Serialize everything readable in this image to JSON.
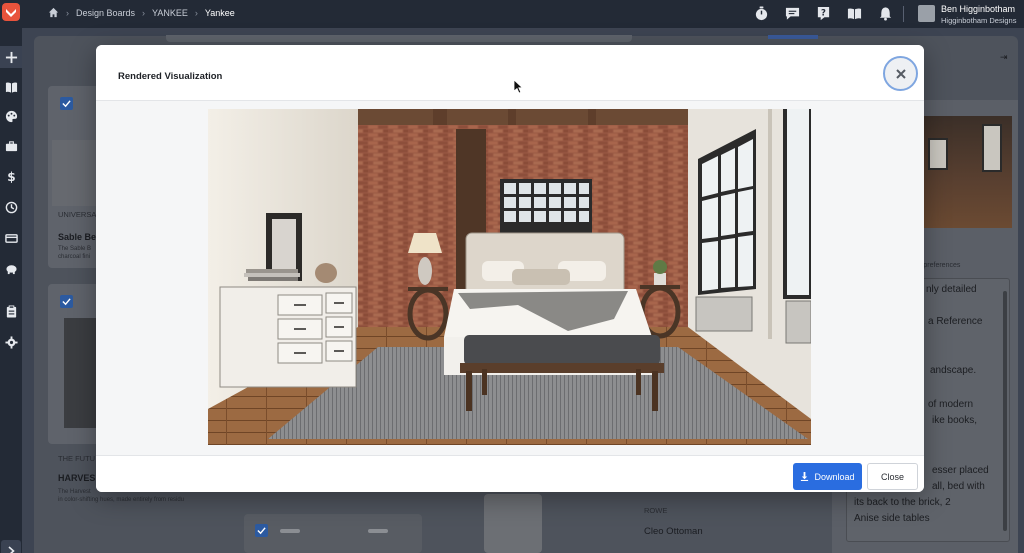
{
  "breadcrumb": {
    "items": [
      "Design Boards",
      "YANKEE",
      "Yankee"
    ]
  },
  "user": {
    "name": "Ben Higginbotham",
    "company": "Higginbotham Designs"
  },
  "topbar_icons": [
    "timer-icon",
    "chat-icon",
    "help-icon",
    "book-icon",
    "bell-icon"
  ],
  "sidebar_icons": [
    "add-icon",
    "catalog-icon",
    "palette-icon",
    "briefcase-icon",
    "dollar-icon",
    "clock-icon",
    "card-icon",
    "piggy-bank-icon",
    "clipboard-icon",
    "settings-icon",
    "chevron-right-icon"
  ],
  "background": {
    "card1": {
      "brand": "UNIVERSA",
      "title": "Sable Be",
      "desc": [
        "The Sable B",
        "charcoal fini"
      ]
    },
    "card2": {
      "brand": "THE FUTU",
      "title": "HARVES",
      "desc": [
        "The Harvest",
        "in color-shifting hues, made entirely from residu"
      ]
    },
    "product": {
      "brand": "ROWE",
      "title": "Cleo Ottoman"
    },
    "notes": {
      "label": "le preferences",
      "lines": [
        "nly detailed",
        "a Reference",
        "andscape.",
        "of modern",
        "ike books,",
        "esser placed",
        "all, bed with",
        "its back to the brick, 2",
        "Anise side tables"
      ]
    }
  },
  "modal": {
    "title": "Rendered Visualization",
    "download_label": "Download",
    "close_label": "Close"
  },
  "colors": {
    "primary": "#2a6de0",
    "topbar": "#232a36",
    "logo": "#e8533c"
  }
}
